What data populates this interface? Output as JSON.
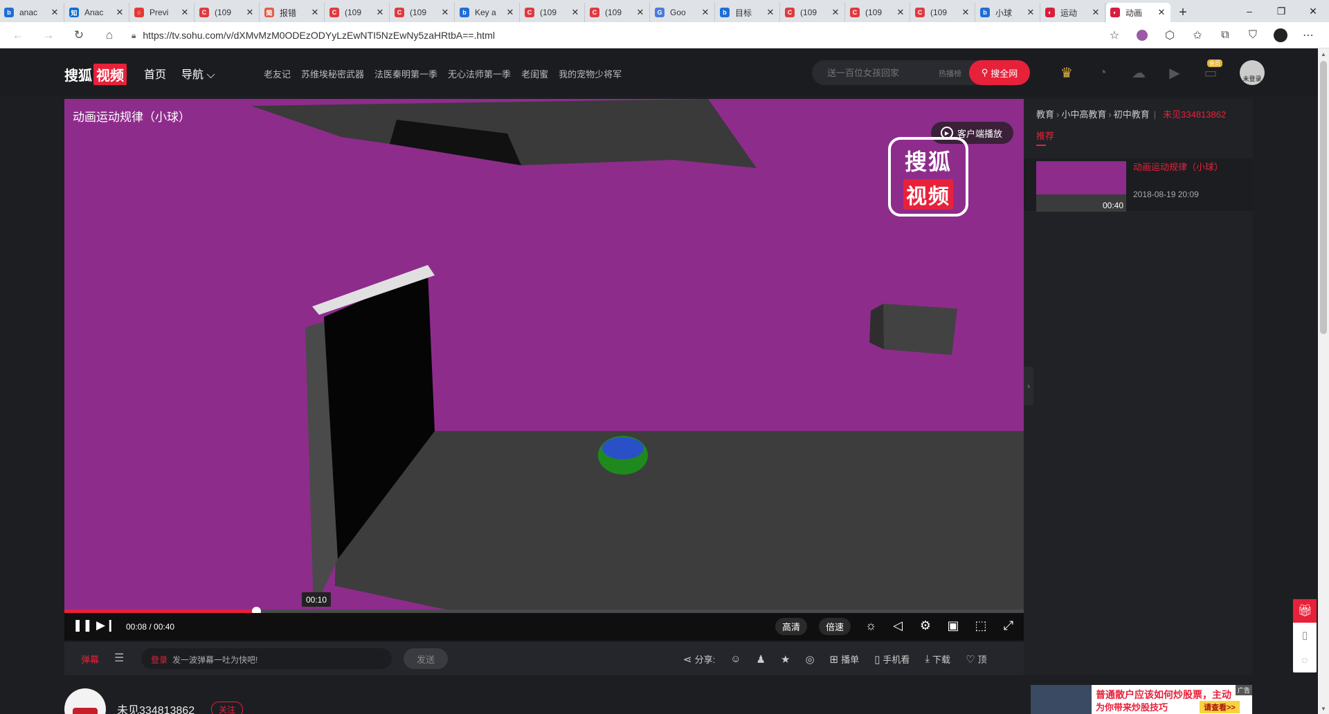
{
  "browser": {
    "tabs": [
      {
        "label": "anac",
        "icon_letter": "b",
        "icon_color": "#1e6ed6"
      },
      {
        "label": "Anac",
        "icon_letter": "知",
        "icon_color": "#0d6cd6"
      },
      {
        "label": "Previ",
        "icon_letter": "○",
        "icon_color": "#e53935"
      },
      {
        "label": "(109",
        "icon_letter": "C",
        "icon_color": "#e03a3e"
      },
      {
        "label": "报错",
        "icon_letter": "简",
        "icon_color": "#e05d4a"
      },
      {
        "label": "(109",
        "icon_letter": "C",
        "icon_color": "#e03a3e"
      },
      {
        "label": "(109",
        "icon_letter": "C",
        "icon_color": "#e03a3e"
      },
      {
        "label": "Key a",
        "icon_letter": "b",
        "icon_color": "#1e6ed6"
      },
      {
        "label": "(109",
        "icon_letter": "C",
        "icon_color": "#e03a3e"
      },
      {
        "label": "(109",
        "icon_letter": "C",
        "icon_color": "#e03a3e"
      },
      {
        "label": "Goo",
        "icon_letter": "G",
        "icon_color": "#4b7bdb"
      },
      {
        "label": "目标",
        "icon_letter": "b",
        "icon_color": "#1e6ed6"
      },
      {
        "label": "(109",
        "icon_letter": "C",
        "icon_color": "#e03a3e"
      },
      {
        "label": "(109",
        "icon_letter": "C",
        "icon_color": "#e03a3e"
      },
      {
        "label": "(109",
        "icon_letter": "C",
        "icon_color": "#e03a3e"
      },
      {
        "label": "小球",
        "icon_letter": "b",
        "icon_color": "#1e6ed6"
      },
      {
        "label": "运动",
        "icon_letter": "◐",
        "icon_color": "#d81e3c"
      },
      {
        "label": "动画",
        "icon_letter": "◐",
        "icon_color": "#d81e3c"
      }
    ],
    "new_tab": "+",
    "url": "https://tv.sohu.com/v/dXMvMzM0ODEzODYyLzEwNTI5NzEwNy5zaHRtbA==.html",
    "win_controls": {
      "minimize": "–",
      "restore": "❐",
      "close": "✕"
    }
  },
  "header": {
    "logo_text": "搜狐",
    "logo_red": "视频",
    "nav": [
      "首页",
      "导航 ⌵"
    ],
    "topics": [
      "老友记",
      "苏维埃秘密武器",
      "法医秦明第一季",
      "无心法师第一季",
      "老闺蜜",
      "我的宠物少将军"
    ],
    "search_placeholder": "送一百位女孩回家",
    "search_hot": "热播榜",
    "search_button": "搜全网",
    "vip_badge": "会员",
    "avatar_label": "未登录"
  },
  "player": {
    "title": "动画运动规律（小球）",
    "client_button": "客户端播放",
    "watermark_top": "搜狐",
    "watermark_bottom": "视频",
    "current_time": "00:08",
    "total_time": "00:40",
    "time_display": "00:08 / 00:40",
    "hover_time": "00:10",
    "progress_fraction": 0.2,
    "quality_label": "高清",
    "speed_label": "倍速"
  },
  "subbar": {
    "danmu_label": "弹幕",
    "login_link": "登录",
    "danmu_placeholder": "发一波弹幕一吐为快吧!",
    "send_button": "发送",
    "share_label": "分享:",
    "actions": [
      "播单",
      "手机看",
      "下载",
      "顶"
    ]
  },
  "uploader": {
    "name": "未见334813862",
    "follow_label": "关注"
  },
  "sidebar": {
    "crumbs": [
      "教育",
      "小中高教育",
      "初中教育"
    ],
    "uploader_name": "未见334813862",
    "tab_label": "推荐",
    "rec": {
      "title": "动画运动规律（小球）",
      "date": "2018-08-19 20:09",
      "duration": "00:40"
    }
  },
  "ad": {
    "line1": "普通散户应该如何炒股票，主动",
    "line2": "为你带来炒股技巧",
    "cta": "请查看>>",
    "label": "广告"
  },
  "colors": {
    "accent": "#e8213a",
    "scene_wall": "#8e2c8c",
    "scene_floor": "#3b3b3b"
  }
}
